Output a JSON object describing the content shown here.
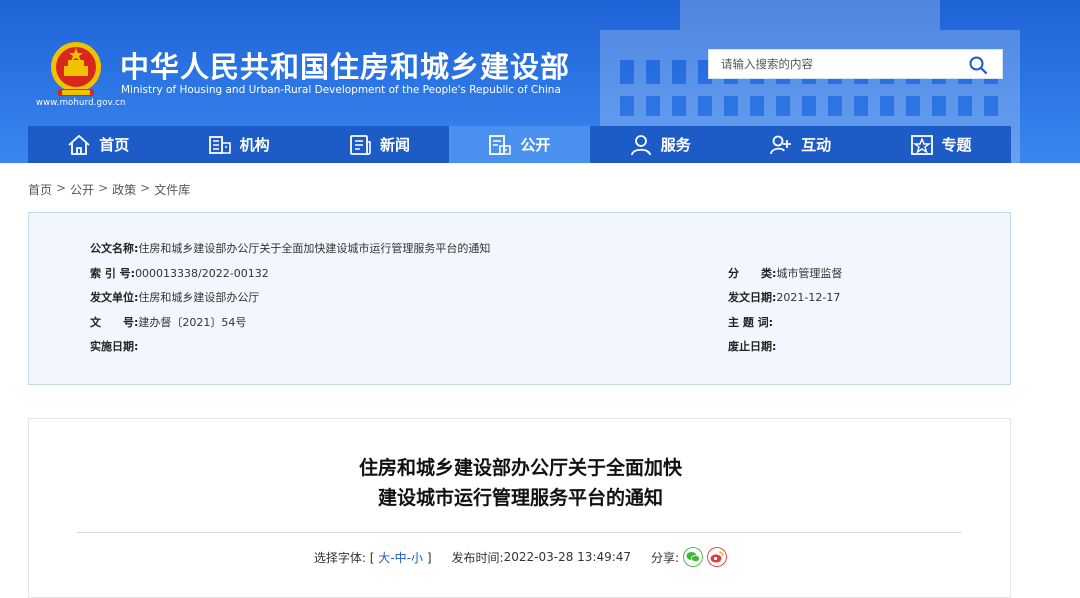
{
  "header": {
    "site_title": "中华人民共和国住房和城乡建设部",
    "site_subtitle": "Ministry of Housing and Urban-Rural Development of the People's Republic of China",
    "site_url": "www.mohurd.gov.cn",
    "search_placeholder": "请输入搜索的内容"
  },
  "nav": {
    "items": [
      {
        "label": "首页",
        "icon": "home-icon"
      },
      {
        "label": "机构",
        "icon": "organization-icon"
      },
      {
        "label": "新闻",
        "icon": "news-icon"
      },
      {
        "label": "公开",
        "icon": "disclosure-icon",
        "active": true
      },
      {
        "label": "服务",
        "icon": "service-icon"
      },
      {
        "label": "互动",
        "icon": "interaction-icon"
      },
      {
        "label": "专题",
        "icon": "topic-icon"
      }
    ]
  },
  "breadcrumb": [
    "首页",
    "公开",
    "政策",
    "文件库"
  ],
  "info": {
    "doc_name_label": "公文名称:",
    "doc_name": "住房和城乡建设部办公厅关于全面加快建设城市运行管理服务平台的通知",
    "index_label": "索 引 号:",
    "index": "000013338/2022-00132",
    "category_label": "分　　类:",
    "category": "城市管理监督",
    "issuer_label": "发文单位:",
    "issuer": "住房和城乡建设部办公厅",
    "issue_date_label": "发文日期:",
    "issue_date": "2021-12-17",
    "doc_no_label": "文　　号:",
    "doc_no": "建办督〔2021〕54号",
    "subject_label": "主 题 词:",
    "subject": "",
    "effective_label": "实施日期:",
    "effective": "",
    "repeal_label": "废止日期:",
    "repeal": ""
  },
  "article": {
    "title_line1": "住房和城乡建设部办公厅关于全面加快",
    "title_line2": "建设城市运行管理服务平台的通知",
    "font_label": "选择字体:",
    "font_open": "[",
    "font_large": "大",
    "font_medium": "中",
    "font_small": "小",
    "font_close": "]",
    "font_dash": "-",
    "publish_label": "发布时间:",
    "publish_time": "2022-03-28 13:49:47",
    "share_label": "分享:"
  },
  "colors": {
    "header_blue": "#2a73e3",
    "nav_blue": "#1d5bc6",
    "nav_active": "#4a91ef",
    "info_bg": "#f2f7fe",
    "wechat_green": "#3fb73a",
    "weibo_red": "#e03c3c"
  }
}
